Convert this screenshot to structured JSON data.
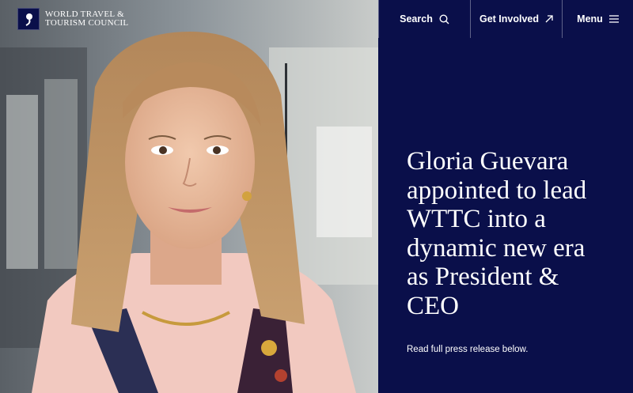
{
  "brand": {
    "name_line1": "WORLD TRAVEL &",
    "name_line2": "TOURISM COUNCIL"
  },
  "nav": {
    "search_label": "Search",
    "search_icon": "search-icon",
    "involved_label": "Get Involved",
    "involved_icon": "arrow-up-right-icon",
    "menu_label": "Menu",
    "menu_icon": "hamburger-icon"
  },
  "hero": {
    "headline": "Gloria Guevara\nappointed to lead\nWTTC into a\ndynamic new era\n as President &\nCEO",
    "subtext": "Read full press release below."
  },
  "colors": {
    "panel_background": "#0a0f4a",
    "text": "#ffffff"
  }
}
